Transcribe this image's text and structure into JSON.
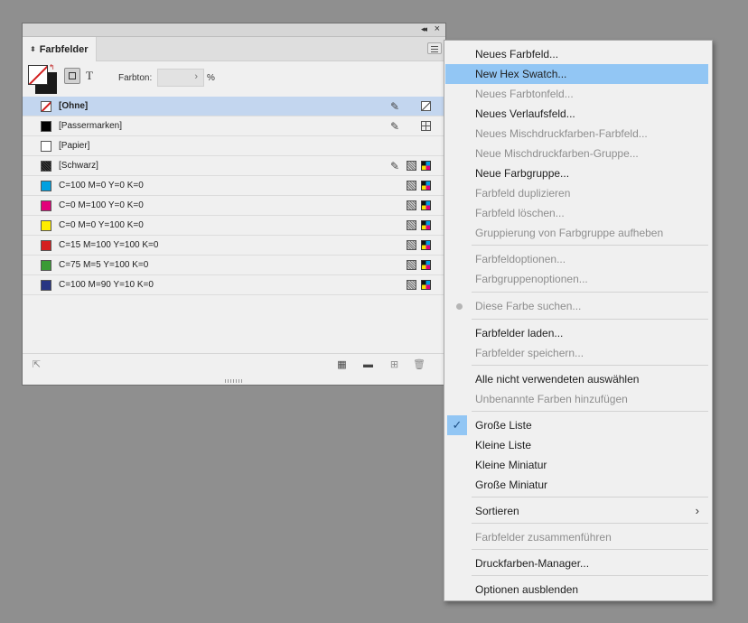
{
  "panel": {
    "tab_label": "Farbfelder",
    "farbton_label": "Farbton:",
    "farbton_value": "",
    "percent": "%",
    "swatches": [
      {
        "name": "[Ohne]",
        "color": "none",
        "selected": true
      },
      {
        "name": "[Passermarken]",
        "color": "#000000"
      },
      {
        "name": "[Papier]",
        "color": "#ffffff"
      },
      {
        "name": "[Schwarz]",
        "color": "#1a1a1a"
      },
      {
        "name": "C=100 M=0 Y=0 K=0",
        "color": "#00a0e0"
      },
      {
        "name": "C=0 M=100 Y=0 K=0",
        "color": "#e2007a"
      },
      {
        "name": "C=0 M=0 Y=100 K=0",
        "color": "#ffed00"
      },
      {
        "name": "C=15 M=100 Y=100 K=0",
        "color": "#d51f1f"
      },
      {
        "name": "C=75 M=5 Y=100 K=0",
        "color": "#3a9b35"
      },
      {
        "name": "C=100 M=90 Y=10 K=0",
        "color": "#283583"
      }
    ]
  },
  "menu": {
    "items": [
      "Neues Farbfeld...",
      "New Hex Swatch...",
      "Neues Farbtonfeld...",
      "Neues Verlaufsfeld...",
      "Neues Mischdruckfarben-Farbfeld...",
      "Neue Mischdruckfarben-Gruppe...",
      "Neue Farbgruppe...",
      "Farbfeld duplizieren",
      "Farbfeld löschen...",
      "Gruppierung von Farbgruppe aufheben",
      "Farbfeldoptionen...",
      "Farbgruppenoptionen...",
      "Diese Farbe suchen...",
      "Farbfelder laden...",
      "Farbfelder speichern...",
      "Alle nicht verwendeten auswählen",
      "Unbenannte Farben hinzufügen",
      "Große Liste",
      "Kleine Liste",
      "Kleine Miniatur",
      "Große Miniatur",
      "Sortieren",
      "Farbfelder zusammenführen",
      "Druckfarben-Manager...",
      "Optionen ausblenden"
    ]
  }
}
